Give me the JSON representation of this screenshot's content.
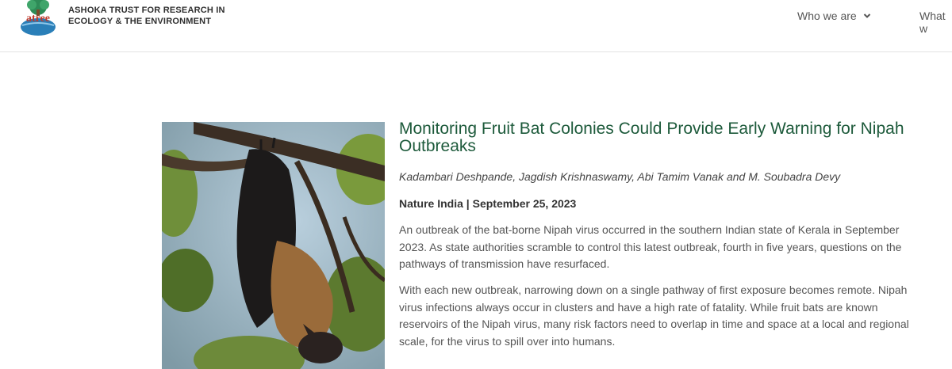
{
  "header": {
    "org_line1": "ASHOKA TRUST FOR RESEARCH IN",
    "org_line2": "ECOLOGY & THE ENVIRONMENT",
    "logo_text": "atree",
    "nav": [
      {
        "label": "Who we are"
      },
      {
        "label": "What w"
      }
    ]
  },
  "article": {
    "title": "Monitoring Fruit Bat Colonies Could Provide Early Warning for Nipah Outbreaks",
    "authors": "Kadambari Deshpande, Jagdish Krishnaswamy, Abi Tamim Vanak and M. Soubadra Devy",
    "source": "Nature India | September 25, 2023",
    "paragraphs": [
      "An outbreak of the bat-borne Nipah virus occurred in the southern Indian state of Kerala in September 2023. As state authorities scramble to control this latest outbreak, fourth in five years, questions on the pathways of transmission have resurfaced.",
      "With each new outbreak, narrowing down on a single pathway of first exposure becomes remote. Nipah virus infections always occur in clusters and have a high rate of fatality. While fruit bats are known reservoirs of the Nipah virus, many risk factors need to overlap in time and space at a local and regional scale, for the virus to spill over into humans."
    ]
  },
  "colors": {
    "title_green": "#1d5a3b",
    "logo_blue": "#2a7fb8",
    "logo_red": "#c0392b"
  }
}
